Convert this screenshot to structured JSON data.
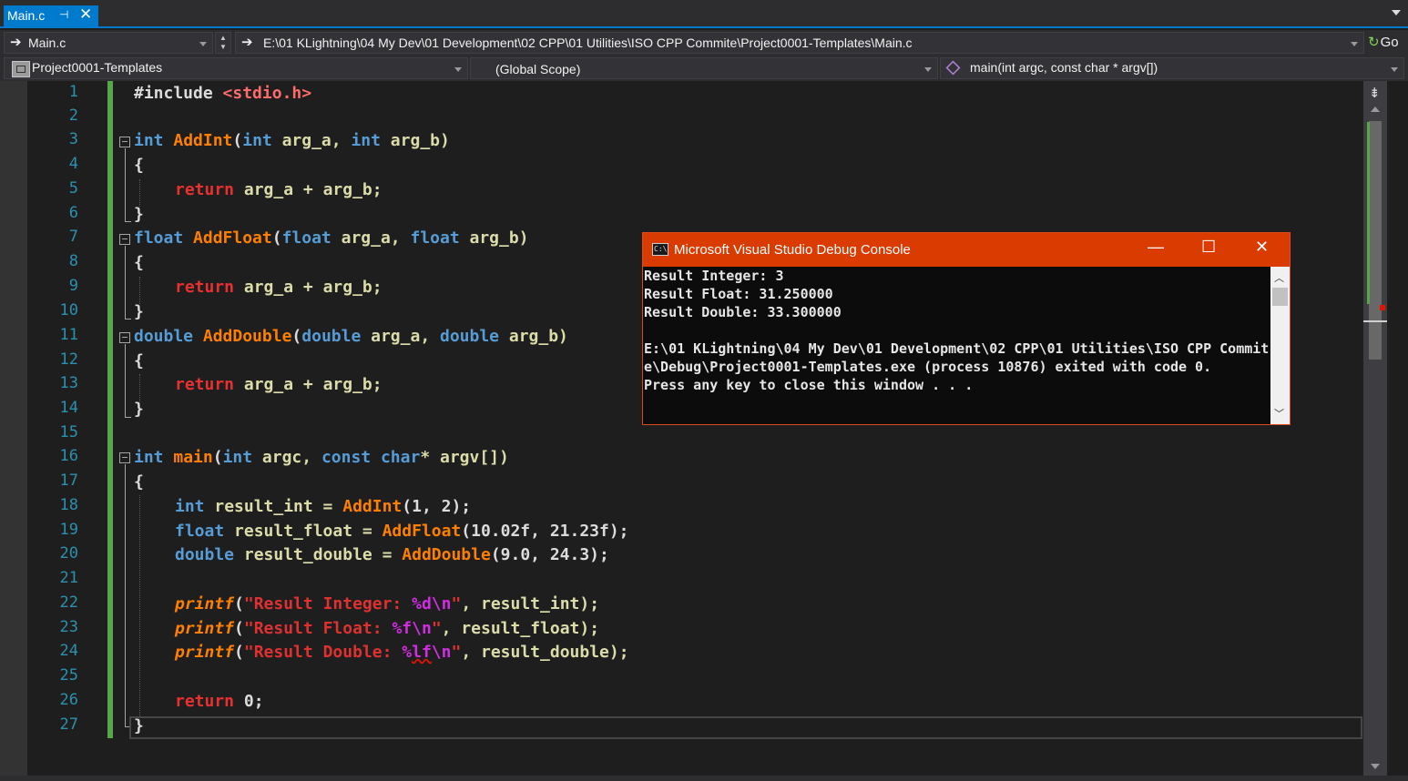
{
  "tab": {
    "title": "Main.c",
    "pin_icon": "pin-icon",
    "close_glyph": "✕"
  },
  "nav": {
    "file_combo": "Main.c",
    "path": "E:\\01 KLightning\\04 My Dev\\01 Development\\02 CPP\\01 Utilities\\ISO CPP Commite\\Project0001-Templates\\Main.c",
    "go_label": "Go",
    "project": "Project0001-Templates",
    "scope": "(Global Scope)",
    "member": "main(int argc, const char * argv[])"
  },
  "editor": {
    "line_numbers": [
      "1",
      "2",
      "3",
      "4",
      "5",
      "6",
      "7",
      "8",
      "9",
      "10",
      "11",
      "12",
      "13",
      "14",
      "15",
      "16",
      "17",
      "18",
      "19",
      "20",
      "21",
      "22",
      "23",
      "24",
      "25",
      "26",
      "27"
    ],
    "t": {
      "l1a": "#include ",
      "l1b": "<stdio.h>",
      "l3a": "int",
      "l3b": " ",
      "l3c": "AddInt",
      "l3d": "(",
      "l3e": "int",
      "l3f": " arg_a, ",
      "l3g": "int",
      "l3h": " arg_b)",
      "brace_open": "{",
      "brace_close": "}",
      "ret": "return",
      "sum": " arg_a + arg_b;",
      "l7a": "float",
      "l7c": "AddFloat",
      "l7e": "float",
      "l11a": "double",
      "l11c": "AddDouble",
      "l11e": "double",
      "l16a": "int",
      "l16c": "main",
      "l16d": "(",
      "l16e": "int",
      "l16f": " argc, ",
      "l16g": "const",
      "l16h": " ",
      "l16i": "char",
      "l16j": "* argv[])",
      "l18a": "int",
      "l18b": " result_int = ",
      "l18c": "AddInt",
      "l18d": "(1, 2);",
      "l19a": "float",
      "l19b": " result_float = ",
      "l19c": "AddFloat",
      "l19d": "(10.02f, 21.23f);",
      "l20a": "double",
      "l20b": " result_double = ",
      "l20c": "AddDouble",
      "l20d": "(9.0, 24.3);",
      "printf": "printf",
      "paren": "(",
      "l22s": "\"Result Integer: ",
      "l22f": "%d",
      "nl": "\\n",
      "q": "\"",
      "l22e": ", result_int);",
      "l23s": "\"Result Float: ",
      "l23f": "%f",
      "l23e": ", result_float);",
      "l24s": "\"Result Double: ",
      "l24f": "%",
      "l24w": "lf",
      "l24e": ", result_double);",
      "l26b": " 0;"
    }
  },
  "console": {
    "title": "Microsoft Visual Studio Debug Console",
    "icon_text": "C:\\",
    "min": "—",
    "max": "☐",
    "close": "✕",
    "lines": [
      "Result Integer: 3",
      "Result Float: 31.250000",
      "Result Double: 33.300000",
      "",
      "E:\\01 KLightning\\04 My Dev\\01 Development\\02 CPP\\01 Utilities\\ISO CPP Commit",
      "e\\Debug\\Project0001-Templates.exe (process 10876) exited with code 0.",
      "Press any key to close this window . . ."
    ]
  },
  "colors": {
    "accent": "#007acc",
    "console_title": "#da3b01",
    "keyword": "#569cd6",
    "function": "#ff8000",
    "string": "#e03131",
    "format": "#d02ee0",
    "line_number": "#2b91af"
  }
}
